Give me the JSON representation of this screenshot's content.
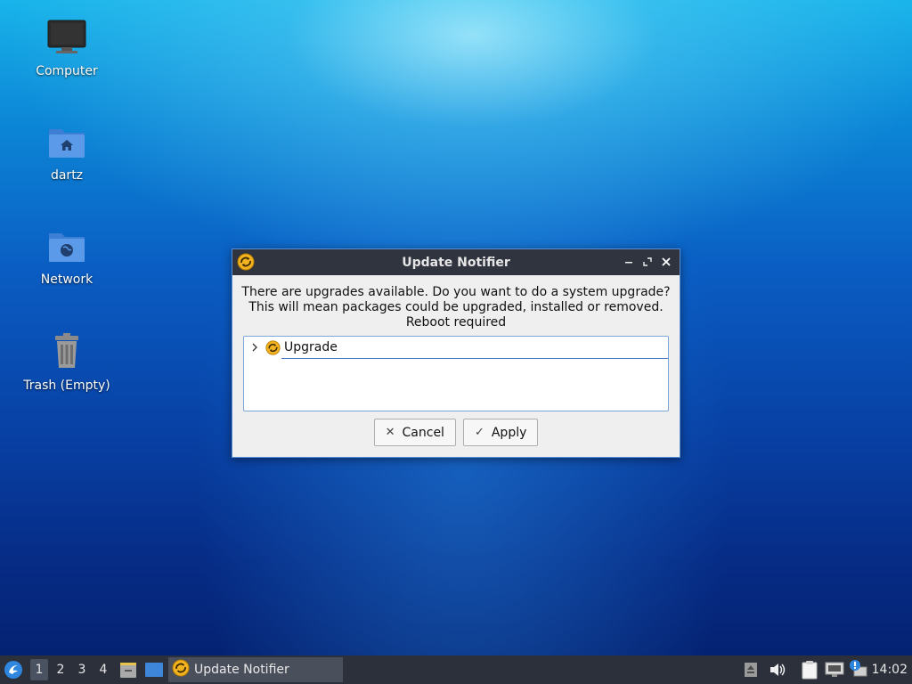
{
  "desktop": {
    "icons": [
      {
        "label": "Computer"
      },
      {
        "label": "dartz"
      },
      {
        "label": "Network"
      },
      {
        "label": "Trash (Empty)"
      }
    ]
  },
  "dialog": {
    "title": "Update Notifier",
    "message_line1": "There are upgrades available. Do you want to do a system upgrade?",
    "message_line2": "This will mean packages could be upgraded, installed or removed.",
    "message_line3": "Reboot required",
    "tree": {
      "items": [
        {
          "label": "Upgrade",
          "expanded": false
        }
      ]
    },
    "cancel_label": "Cancel",
    "apply_label": "Apply"
  },
  "taskbar": {
    "workspaces": [
      "1",
      "2",
      "3",
      "4"
    ],
    "active_workspace": "1",
    "task_label": "Update Notifier",
    "clock": "14:02"
  },
  "colors": {
    "titlebar_bg": "#2f343f",
    "taskbar_bg": "#2b303b",
    "accent": "#4a7cc4"
  }
}
